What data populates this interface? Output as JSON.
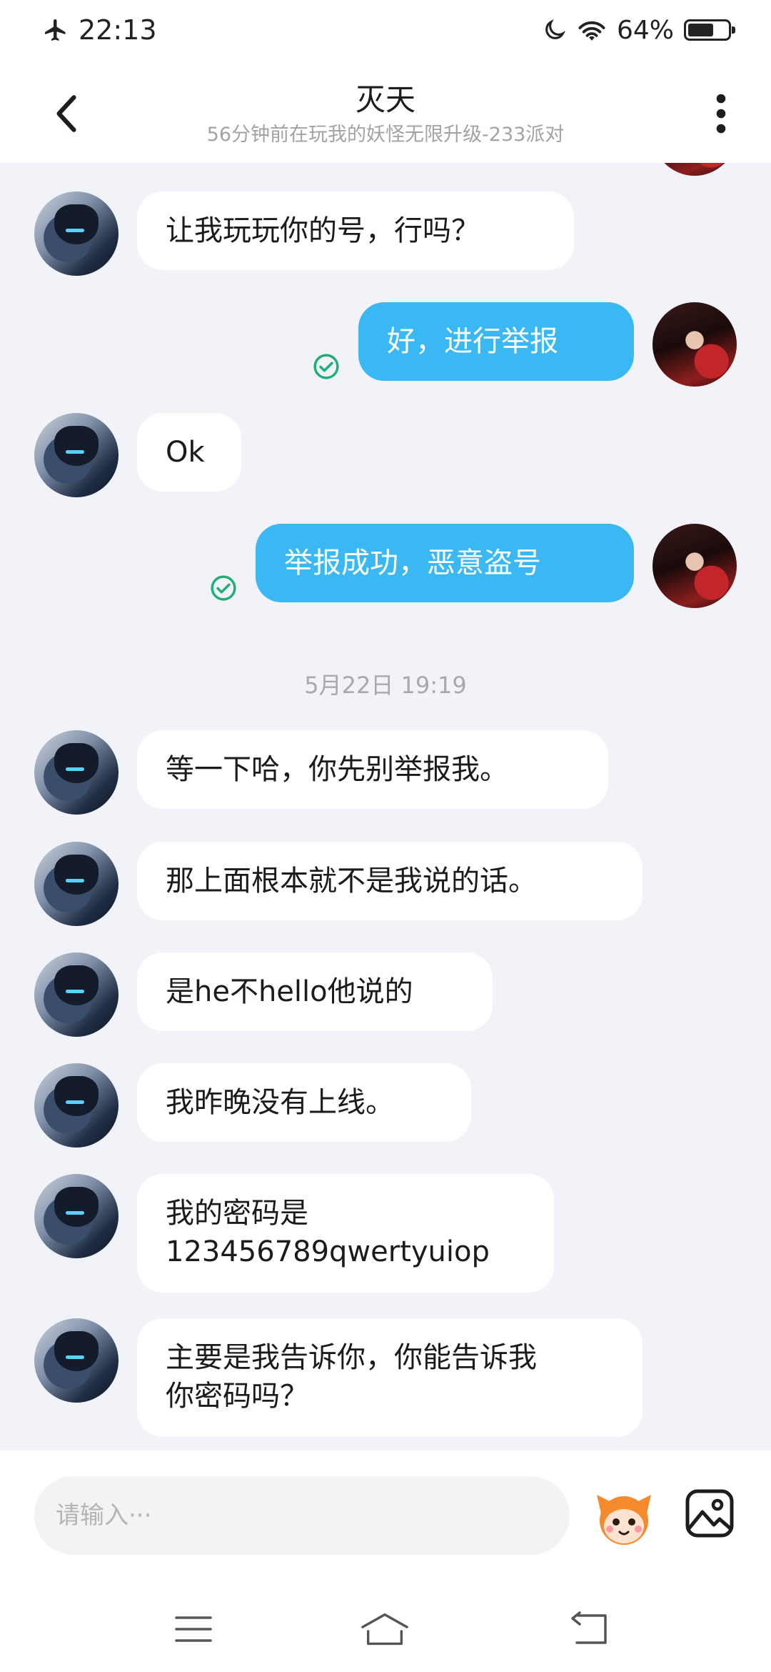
{
  "status_bar": {
    "time": "22:13",
    "battery_percent_text": "64%",
    "battery_level": 0.64,
    "airplane_icon": "airplane-icon",
    "dnd_icon": "moon-icon",
    "wifi_icon": "wifi-icon"
  },
  "header": {
    "title": "灭天",
    "subtitle": "56分钟前在玩我的妖怪无限升级-233派对",
    "back_icon": "back-arrow-icon",
    "more_icon": "more-vertical-icon"
  },
  "messages": [
    {
      "side": "left",
      "text": "让我玩玩你的号，行吗？"
    },
    {
      "side": "right",
      "text": "好，进行举报",
      "status": "sent-check"
    },
    {
      "side": "left",
      "text": "Ok"
    },
    {
      "side": "right",
      "text": "举报成功，恶意盗号",
      "status": "sent-check"
    }
  ],
  "timestamp": "5月22日 19:19",
  "messages_after": [
    {
      "side": "left",
      "text": "等一下哈，你先别举报我。"
    },
    {
      "side": "left",
      "text": "那上面根本就不是我说的话。"
    },
    {
      "side": "left",
      "text": "是he不hello他说的"
    },
    {
      "side": "left",
      "text": "我昨晚没有上线。"
    },
    {
      "side": "left",
      "line1": "我的密码是",
      "line2": "123456789qwertyuiop"
    },
    {
      "side": "left",
      "line1": "主要是我告诉你，你能告诉我",
      "line2": "你密码吗？"
    }
  ],
  "input": {
    "placeholder": "请输入···",
    "emoji_icon": "emoji-face-icon",
    "image_icon": "image-icon"
  },
  "nav": {
    "menu_icon": "menu-icon",
    "home_icon": "home-icon",
    "back_icon": "back-icon"
  },
  "colors": {
    "accent_bubble": "#3ab8f3",
    "check_green": "#1fae74",
    "chat_bg": "#f1f3f9"
  }
}
